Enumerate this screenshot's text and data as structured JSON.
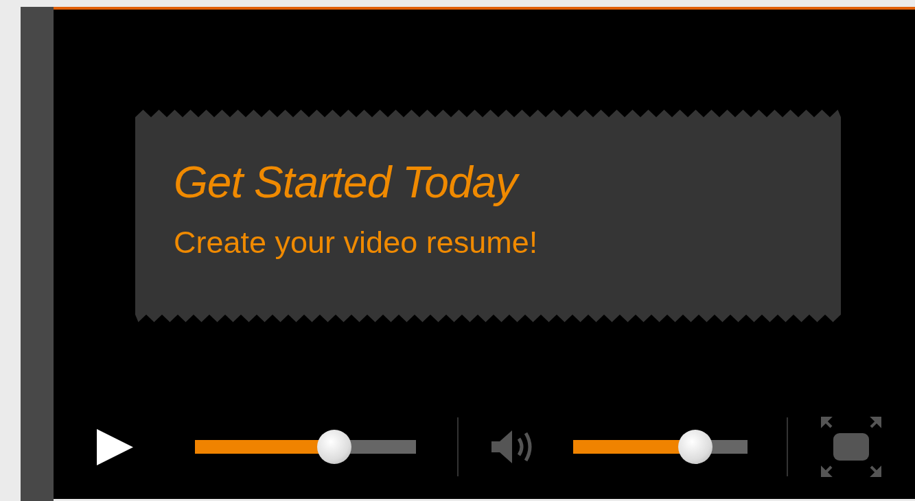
{
  "banner": {
    "title": "Get Started Today",
    "subtitle": "Create your video resume!"
  },
  "controls": {
    "playing": false,
    "progress": {
      "level": 0.63
    },
    "volume": {
      "level": 0.7
    }
  }
}
